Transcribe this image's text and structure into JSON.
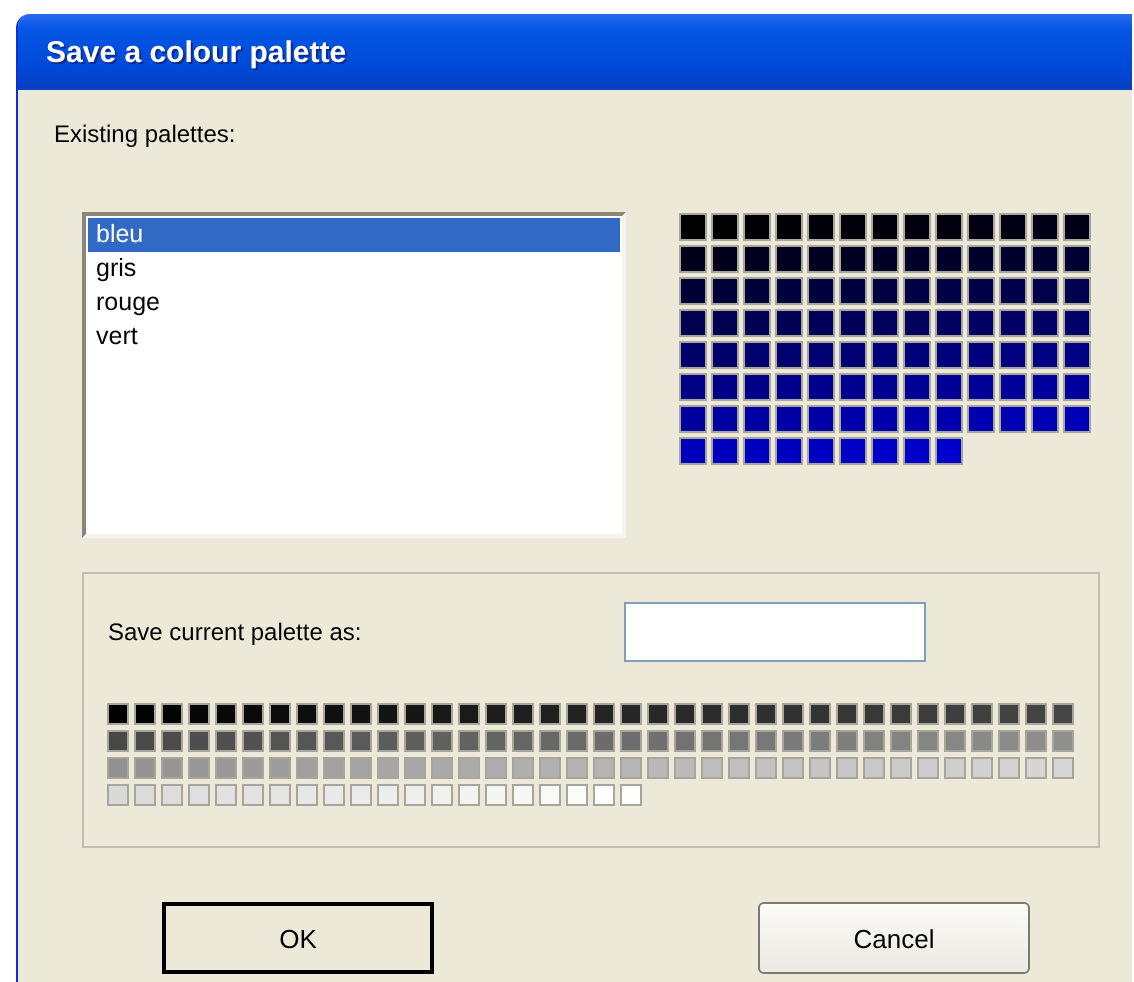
{
  "window": {
    "title": "Save a colour palette"
  },
  "existing_label": "Existing palettes:",
  "palettes": [
    {
      "label": "bleu",
      "selected": true
    },
    {
      "label": "gris",
      "selected": false
    },
    {
      "label": "rouge",
      "selected": false
    },
    {
      "label": "vert",
      "selected": false
    }
  ],
  "save_group": {
    "label": "Save current palette as:"
  },
  "buttons": [
    {
      "label": "OK",
      "default": true
    },
    {
      "label": "Cancel",
      "default": false
    }
  ]
}
